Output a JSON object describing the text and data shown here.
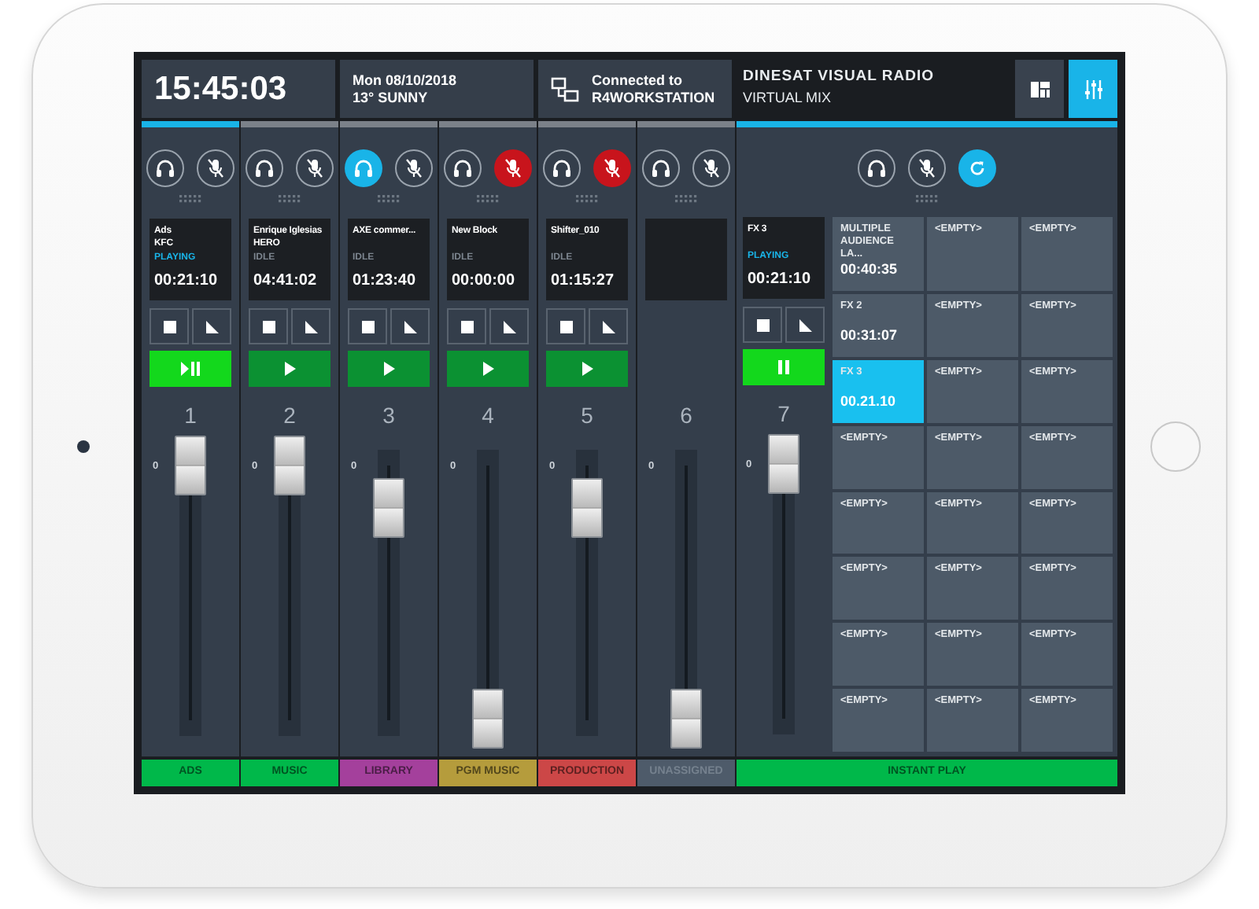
{
  "clock": "15:45:03",
  "date": "Mon 08/10/2018",
  "weather": "13° SUNNY",
  "connection": {
    "label": "Connected to",
    "host": "R4WORKSTATION"
  },
  "app": {
    "title": "DINESAT VISUAL RADIO",
    "subtitle": "VIRTUAL MIX"
  },
  "view_buttons": [
    {
      "selected": false
    },
    {
      "selected": true
    }
  ],
  "channels": [
    {
      "kind": "player",
      "number": "1",
      "active": true,
      "listen": false,
      "muted": false,
      "title": "Ads",
      "subtitle": "KFC",
      "status": "PLAYING",
      "time": "00:21:10",
      "playing": true,
      "scale": "0",
      "level": 1.0,
      "label": "ADS",
      "color": "#00b84a"
    },
    {
      "kind": "player",
      "number": "2",
      "active": false,
      "listen": false,
      "muted": false,
      "title": "Enrique Iglesias",
      "subtitle": "HERO",
      "status": "IDLE",
      "time": "04:41:02",
      "playing": false,
      "scale": "0",
      "level": 1.0,
      "label": "MUSIC",
      "color": "#00b84a"
    },
    {
      "kind": "player",
      "number": "3",
      "active": false,
      "listen": true,
      "muted": false,
      "title": "AXE commer...",
      "status": "IDLE",
      "time": "01:23:40",
      "playing": false,
      "scale": "0",
      "level": 0.83,
      "label": "LIBRARY",
      "color": "#a4409c"
    },
    {
      "kind": "player",
      "number": "4",
      "active": false,
      "listen": false,
      "muted": true,
      "title": "New Block",
      "status": "IDLE",
      "time": "00:00:00",
      "playing": false,
      "scale": "0",
      "level": 0.0,
      "label": "PGM MUSIC",
      "color": "#b59c3c"
    },
    {
      "kind": "player",
      "number": "5",
      "active": false,
      "listen": false,
      "muted": true,
      "title": "Shifter_010",
      "status": "IDLE",
      "time": "01:15:27",
      "playing": false,
      "scale": "0",
      "level": 0.83,
      "label": "PRODUCTION",
      "color": "#cc4747"
    },
    {
      "kind": "empty",
      "number": "6",
      "active": false,
      "listen": false,
      "muted": false,
      "scale": "0",
      "level": 0.0,
      "label": "UNASSIGNED",
      "color": "#4e5b6a"
    }
  ],
  "instant_play": {
    "active": true,
    "listen": false,
    "muted": false,
    "repeat": true,
    "number": "7",
    "title": "FX 3",
    "status": "PLAYING",
    "time": "00:21:10",
    "playing": true,
    "scale": "0",
    "level": 1.0,
    "label": "INSTANT PLAY",
    "color": "#00b84a",
    "cells": [
      {
        "title": "MULTIPLE AUDIENCE LA...",
        "time": "00:40:35",
        "selected": false
      },
      {
        "title": "<EMPTY>",
        "selected": false
      },
      {
        "title": "<EMPTY>",
        "selected": false
      },
      {
        "title": "FX 2",
        "time": "00:31:07",
        "selected": false
      },
      {
        "title": "<EMPTY>",
        "selected": false
      },
      {
        "title": "<EMPTY>",
        "selected": false
      },
      {
        "title": "FX 3",
        "time": "00.21.10",
        "selected": true
      },
      {
        "title": "<EMPTY>",
        "selected": false
      },
      {
        "title": "<EMPTY>",
        "selected": false
      },
      {
        "title": "<EMPTY>",
        "selected": false
      },
      {
        "title": "<EMPTY>",
        "selected": false
      },
      {
        "title": "<EMPTY>",
        "selected": false
      },
      {
        "title": "<EMPTY>",
        "selected": false
      },
      {
        "title": "<EMPTY>",
        "selected": false
      },
      {
        "title": "<EMPTY>",
        "selected": false
      },
      {
        "title": "<EMPTY>",
        "selected": false
      },
      {
        "title": "<EMPTY>",
        "selected": false
      },
      {
        "title": "<EMPTY>",
        "selected": false
      },
      {
        "title": "<EMPTY>",
        "selected": false
      },
      {
        "title": "<EMPTY>",
        "selected": false
      },
      {
        "title": "<EMPTY>",
        "selected": false
      },
      {
        "title": "<EMPTY>",
        "selected": false
      },
      {
        "title": "<EMPTY>",
        "selected": false
      },
      {
        "title": "<EMPTY>",
        "selected": false
      }
    ]
  }
}
